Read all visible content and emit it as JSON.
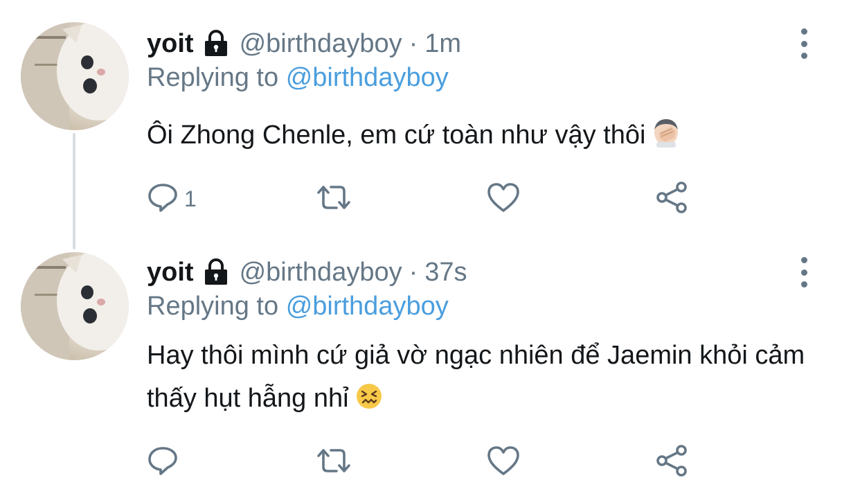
{
  "tweets": [
    {
      "name": "yoit",
      "handle": "@birthdayboy",
      "separator": "·",
      "time": "1m",
      "replying_prefix": "Replying to",
      "replying_to": "@birthdayboy",
      "text": "Ôi Zhong Chenle, em cứ toàn như vậy thôi",
      "emoji": "face-palm-emoji",
      "reply_count": "1"
    },
    {
      "name": "yoit",
      "handle": "@birthdayboy",
      "separator": "·",
      "time": "37s",
      "replying_prefix": "Replying to",
      "replying_to": "@birthdayboy",
      "text": "Hay thôi mình cứ giả vờ ngạc nhiên để Jaemin khỏi cảm thấy hụt hẫng nhỉ",
      "emoji": "confounded-face-emoji",
      "reply_count": ""
    }
  ],
  "icons": {
    "lock": "lock-icon",
    "more": "more-vertical-icon",
    "reply": "reply-bubble-icon",
    "retweet": "retweet-icon",
    "like": "heart-icon",
    "share": "share-icon"
  },
  "colors": {
    "text": "#14171a",
    "secondary": "#657786",
    "link": "#4a9ede",
    "thread_line": "#d9dde1"
  }
}
